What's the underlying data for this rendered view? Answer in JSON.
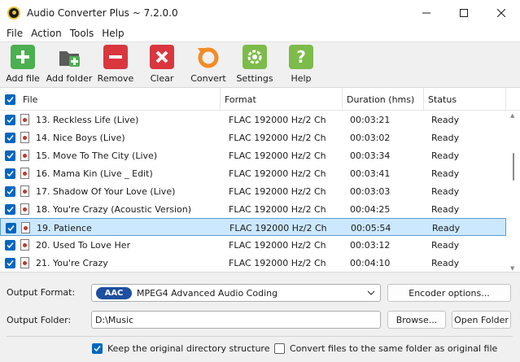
{
  "window": {
    "title": "Audio Converter Plus ~ 7.2.0.0"
  },
  "menu": [
    {
      "label": "File"
    },
    {
      "label": "Action"
    },
    {
      "label": "Tools"
    },
    {
      "label": "Help"
    }
  ],
  "toolbar": [
    {
      "label": "Add file",
      "icon": "add-file-icon",
      "color": "#4caf50"
    },
    {
      "label": "Add folder",
      "icon": "add-folder-icon",
      "color": "#5b5b5b"
    },
    {
      "label": "Remove",
      "icon": "remove-icon",
      "color": "#d9363e"
    },
    {
      "label": "Clear",
      "icon": "clear-icon",
      "color": "#d9363e"
    },
    {
      "label": "Convert",
      "icon": "convert-icon",
      "color": "#f28c28"
    },
    {
      "label": "Settings",
      "icon": "settings-icon",
      "color": "#6fbf3f"
    },
    {
      "label": "Help",
      "icon": "help-icon",
      "color": "#6fbf3f"
    }
  ],
  "table": {
    "columns": [
      "File",
      "Format",
      "Duration (hms)",
      "Status"
    ],
    "rows": [
      {
        "file": "13. Reckless Life (Live)",
        "format": "FLAC 192000 Hz/2 Ch",
        "duration": "00:03:21",
        "status": "Ready"
      },
      {
        "file": "14. Nice Boys (Live)",
        "format": "FLAC 192000 Hz/2 Ch",
        "duration": "00:03:02",
        "status": "Ready"
      },
      {
        "file": "15. Move To The City (Live)",
        "format": "FLAC 192000 Hz/2 Ch",
        "duration": "00:03:34",
        "status": "Ready"
      },
      {
        "file": "16. Mama Kin (Live _ Edit)",
        "format": "FLAC 192000 Hz/2 Ch",
        "duration": "00:03:41",
        "status": "Ready"
      },
      {
        "file": "17. Shadow Of Your Love (Live)",
        "format": "FLAC 192000 Hz/2 Ch",
        "duration": "00:03:03",
        "status": "Ready"
      },
      {
        "file": "18. You're Crazy (Acoustic Version)",
        "format": "FLAC 192000 Hz/2 Ch",
        "duration": "00:04:25",
        "status": "Ready"
      },
      {
        "file": "19. Patience",
        "format": "FLAC 192000 Hz/2 Ch",
        "duration": "00:05:54",
        "status": "Ready",
        "selected": true
      },
      {
        "file": "20. Used To Love Her",
        "format": "FLAC 192000 Hz/2 Ch",
        "duration": "00:03:12",
        "status": "Ready"
      },
      {
        "file": "21. You're Crazy",
        "format": "FLAC 192000 Hz/2 Ch",
        "duration": "00:04:10",
        "status": "Ready"
      }
    ]
  },
  "output": {
    "format_label": "Output Format:",
    "format_badge": "AAC",
    "format_value": "MPEG4 Advanced Audio Coding",
    "encoder_button": "Encoder options...",
    "folder_label": "Output Folder:",
    "folder_value": "D:\\Music",
    "browse_button": "Browse...",
    "open_folder_button": "Open Folder",
    "keep_structure_label": "Keep the original directory structure",
    "keep_structure_checked": true,
    "same_folder_label": "Convert files to the same folder as original file",
    "same_folder_checked": false
  },
  "colors": {
    "accent": "#0067c0",
    "selection": "#cce8ff",
    "badge": "#1f4fa0"
  }
}
